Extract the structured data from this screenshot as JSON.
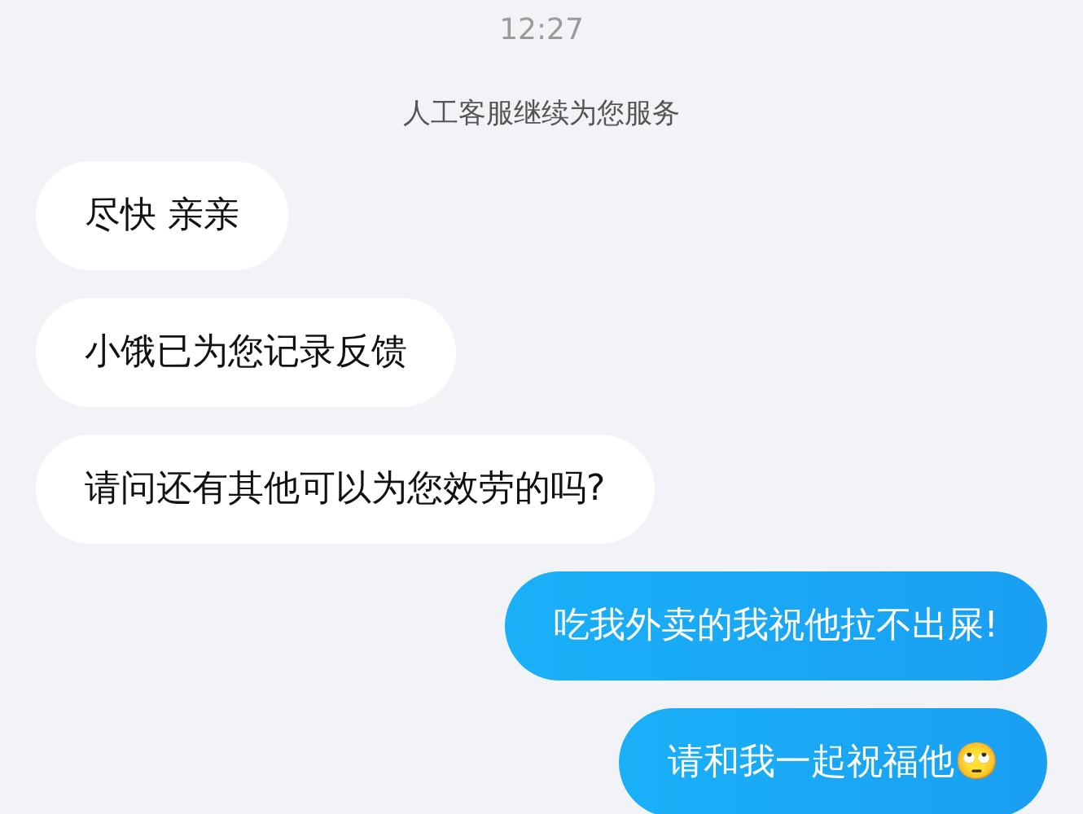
{
  "time": "12:27",
  "notice": "人工客服继续为您服务",
  "messages": [
    {
      "kind": "received",
      "text": "尽快 亲亲"
    },
    {
      "kind": "received",
      "text": "小饿已为您记录反馈"
    },
    {
      "kind": "received",
      "text": "请问还有其他可以为您效劳的吗?"
    },
    {
      "kind": "sent",
      "text": "吃我外卖的我祝他拉不出屎!"
    },
    {
      "kind": "sent",
      "text": "请和我一起祝福他🙄"
    }
  ]
}
